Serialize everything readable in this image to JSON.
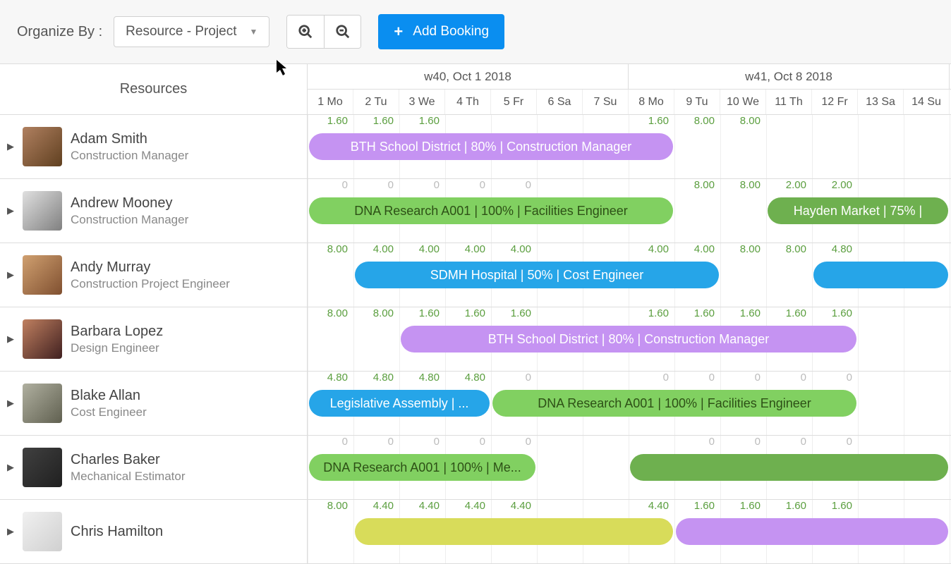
{
  "toolbar": {
    "organize_label": "Organize By :",
    "dropdown_value": "Resource - Project",
    "add_button": "Add Booking"
  },
  "header": {
    "resources_label": "Resources",
    "weeks": [
      {
        "label": "w40, Oct 1 2018",
        "span": 7
      },
      {
        "label": "w41, Oct 8 2018",
        "span": 7
      }
    ],
    "days": [
      "1 Mo",
      "2 Tu",
      "3 We",
      "4 Th",
      "5 Fr",
      "6 Sa",
      "7 Su",
      "8 Mo",
      "9 Tu",
      "10 We",
      "11 Th",
      "12 Fr",
      "13 Sa",
      "14 Su"
    ]
  },
  "resources": [
    {
      "name": "Adam Smith",
      "role": "Construction Manager",
      "avatar_class": "av1",
      "hours": [
        "1.60",
        "1.60",
        "1.60",
        "",
        "",
        "",
        "",
        "1.60",
        "8.00",
        "8.00",
        "",
        "",
        "",
        ""
      ],
      "bars": [
        {
          "label": "BTH School District | 80% | Construction Manager",
          "color": "purple",
          "start": 0,
          "span": 8
        }
      ]
    },
    {
      "name": "Andrew Mooney",
      "role": "Construction Manager",
      "avatar_class": "av2",
      "hours": [
        "0",
        "0",
        "0",
        "0",
        "0",
        "",
        "",
        "",
        "8.00",
        "8.00",
        "2.00",
        "2.00",
        "",
        ""
      ],
      "bars": [
        {
          "label": "DNA Research A001 | 100% | Facilities Engineer",
          "color": "green",
          "start": 0,
          "span": 8
        },
        {
          "label": "Hayden Market | 75% |",
          "color": "green2",
          "start": 10,
          "span": 4
        }
      ]
    },
    {
      "name": "Andy Murray",
      "role": "Construction Project Engineer",
      "avatar_class": "av3",
      "hours": [
        "8.00",
        "4.00",
        "4.00",
        "4.00",
        "4.00",
        "",
        "",
        "4.00",
        "4.00",
        "8.00",
        "8.00",
        "4.80",
        "",
        ""
      ],
      "bars": [
        {
          "label": "SDMH Hospital | 50% | Cost Engineer",
          "color": "blue",
          "start": 1,
          "span": 8
        },
        {
          "label": "",
          "color": "blue",
          "start": 11,
          "span": 3
        }
      ]
    },
    {
      "name": "Barbara Lopez",
      "role": "Design Engineer",
      "avatar_class": "av4",
      "hours": [
        "8.00",
        "8.00",
        "1.60",
        "1.60",
        "1.60",
        "",
        "",
        "1.60",
        "1.60",
        "1.60",
        "1.60",
        "1.60",
        "",
        ""
      ],
      "bars": [
        {
          "label": "BTH School District | 80% | Construction Manager",
          "color": "purple",
          "start": 2,
          "span": 10
        }
      ]
    },
    {
      "name": "Blake Allan",
      "role": "Cost Engineer",
      "avatar_class": "av5",
      "hours": [
        "4.80",
        "4.80",
        "4.80",
        "4.80",
        "0",
        "",
        "",
        "0",
        "0",
        "0",
        "0",
        "0",
        "",
        ""
      ],
      "bars": [
        {
          "label": "Legislative Assembly | ...",
          "color": "blue",
          "start": 0,
          "span": 4
        },
        {
          "label": "DNA Research A001 | 100% | Facilities Engineer",
          "color": "green",
          "start": 4,
          "span": 8
        }
      ]
    },
    {
      "name": "Charles Baker",
      "role": "Mechanical Estimator",
      "avatar_class": "av6",
      "hours": [
        "0",
        "0",
        "0",
        "0",
        "0",
        "",
        "",
        "",
        "0",
        "0",
        "0",
        "0",
        "",
        ""
      ],
      "bars": [
        {
          "label": "DNA Research A001 | 100% | Me...",
          "color": "green",
          "start": 0,
          "span": 5
        },
        {
          "label": "",
          "color": "green2",
          "start": 7,
          "span": 7
        }
      ]
    },
    {
      "name": "Chris Hamilton",
      "role": "",
      "avatar_class": "av7",
      "hours": [
        "8.00",
        "4.40",
        "4.40",
        "4.40",
        "4.40",
        "",
        "",
        "4.40",
        "1.60",
        "1.60",
        "1.60",
        "1.60",
        "",
        ""
      ],
      "bars": [
        {
          "label": "",
          "color": "yellow",
          "start": 1,
          "span": 7
        },
        {
          "label": "",
          "color": "purple",
          "start": 8,
          "span": 6
        }
      ]
    }
  ]
}
